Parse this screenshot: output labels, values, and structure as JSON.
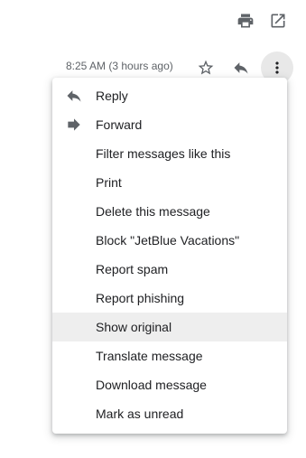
{
  "toolbar": {
    "print_icon": "print-icon",
    "popout_icon": "open-in-new-window-icon"
  },
  "message_header": {
    "timestamp": "8:25 AM (3 hours ago)",
    "star_icon": "star-outline-icon",
    "reply_icon": "reply-icon",
    "more_icon": "more-vertical-icon"
  },
  "menu": {
    "items": [
      {
        "label": "Reply",
        "icon": "reply-icon"
      },
      {
        "label": "Forward",
        "icon": "forward-icon"
      },
      {
        "label": "Filter messages like this"
      },
      {
        "label": "Print"
      },
      {
        "label": "Delete this message"
      },
      {
        "label": "Block \"JetBlue Vacations\""
      },
      {
        "label": "Report spam"
      },
      {
        "label": "Report phishing"
      },
      {
        "label": "Show original",
        "highlighted": true
      },
      {
        "label": "Translate message"
      },
      {
        "label": "Download message"
      },
      {
        "label": "Mark as unread"
      }
    ]
  },
  "colors": {
    "icon": "#5f6368",
    "text": "#202124",
    "highlight": "#eeeeee",
    "more_button_bg": "#e8e8e8"
  }
}
